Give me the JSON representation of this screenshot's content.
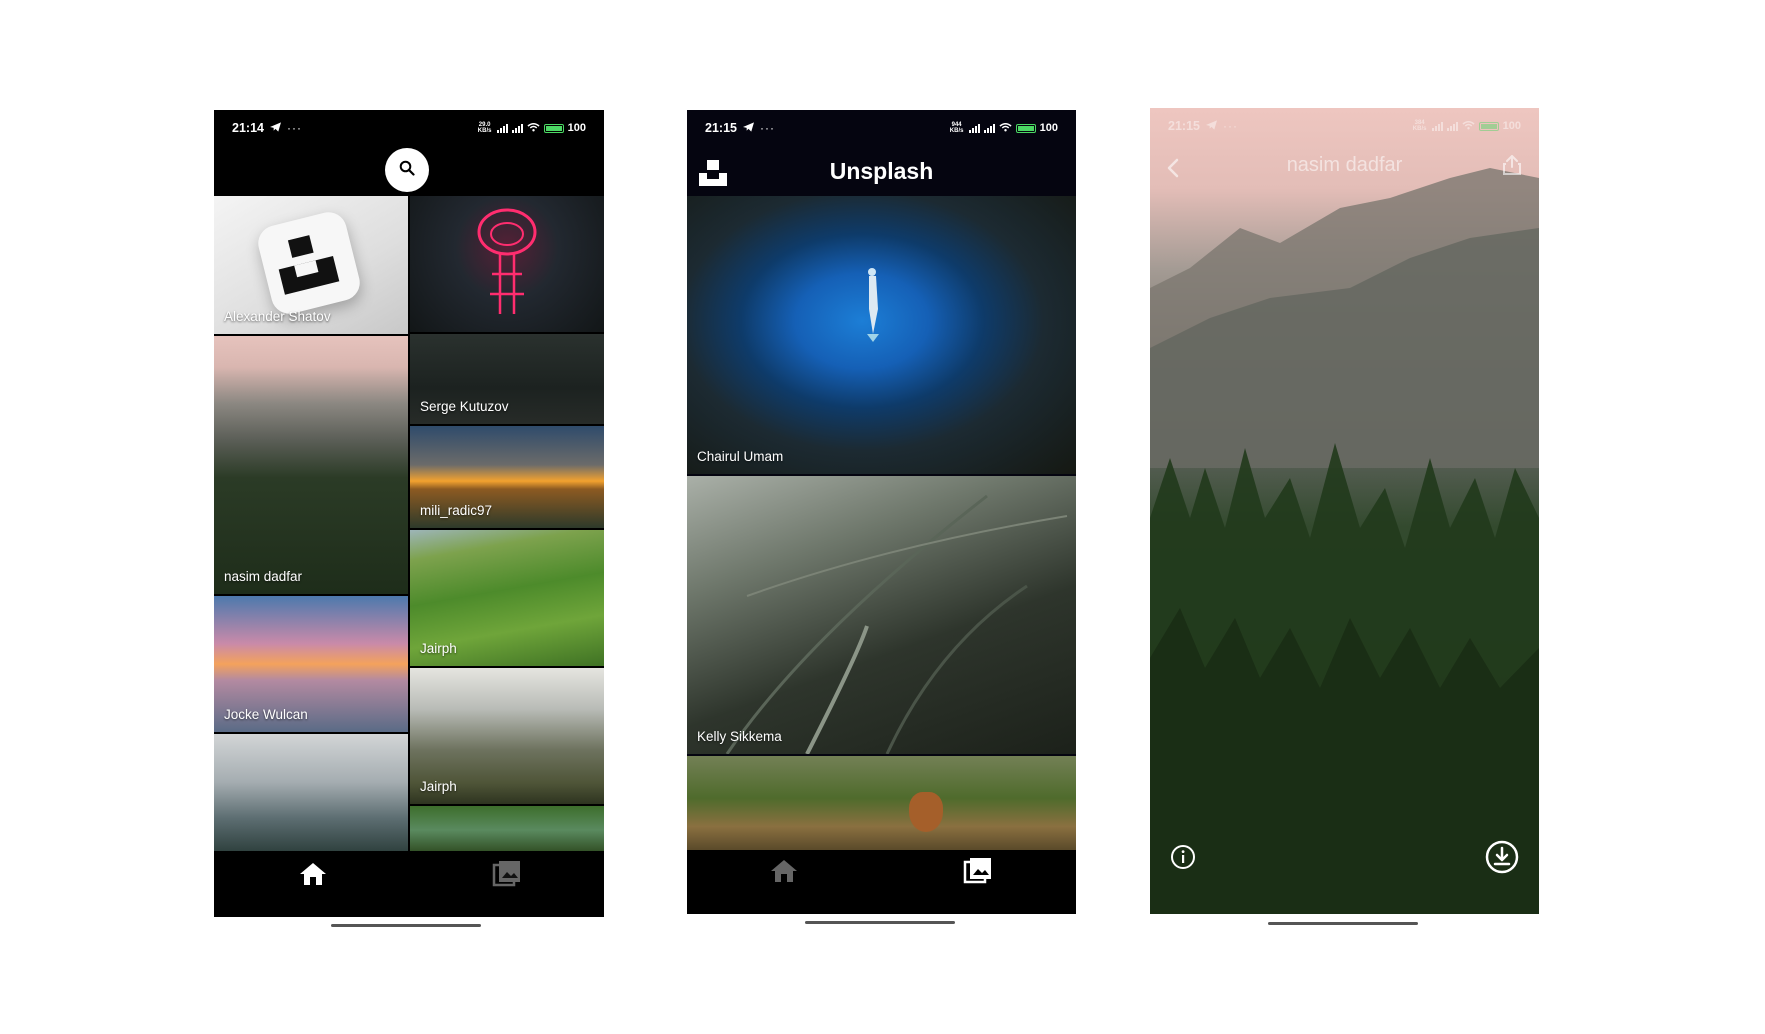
{
  "colors": {
    "bar_bg": "#000000",
    "header_bg": "#050510",
    "battery": "#4cd964",
    "text": "#ffffff"
  },
  "screen1": {
    "status": {
      "time": "21:14",
      "speed": "29.0 KB/s",
      "battery_pct": "100"
    },
    "search_icon": "search-icon",
    "left_column": [
      {
        "author": "Alexander Shatov"
      },
      {
        "author": "nasim dadfar"
      },
      {
        "author": "Jocke Wulcan"
      },
      {
        "author": ""
      }
    ],
    "right_column": [
      {
        "author": ""
      },
      {
        "author": "Serge Kutuzov"
      },
      {
        "author": "mili_radic97"
      },
      {
        "author": "Jairph"
      },
      {
        "author": "Jairph"
      },
      {
        "author": ""
      }
    ],
    "nav": {
      "home_icon": "home-icon",
      "gallery_icon": "gallery-icon",
      "active": "home"
    }
  },
  "screen2": {
    "status": {
      "time": "21:15",
      "speed": "944 KB/s",
      "battery_pct": "100"
    },
    "title": "Unsplash",
    "logo_icon": "unsplash-logo-icon",
    "photos": [
      {
        "author": "Chairul Umam"
      },
      {
        "author": "Kelly Sikkema"
      },
      {
        "author": ""
      }
    ],
    "nav": {
      "home_icon": "home-icon",
      "gallery_icon": "gallery-icon",
      "active": "gallery"
    }
  },
  "screen3": {
    "status": {
      "time": "21:15",
      "speed": "384 KB/s",
      "battery_pct": "100"
    },
    "title": "nasim dadfar",
    "back_icon": "back-chevron-icon",
    "share_icon": "share-icon",
    "info_icon": "info-icon",
    "download_icon": "download-icon"
  }
}
